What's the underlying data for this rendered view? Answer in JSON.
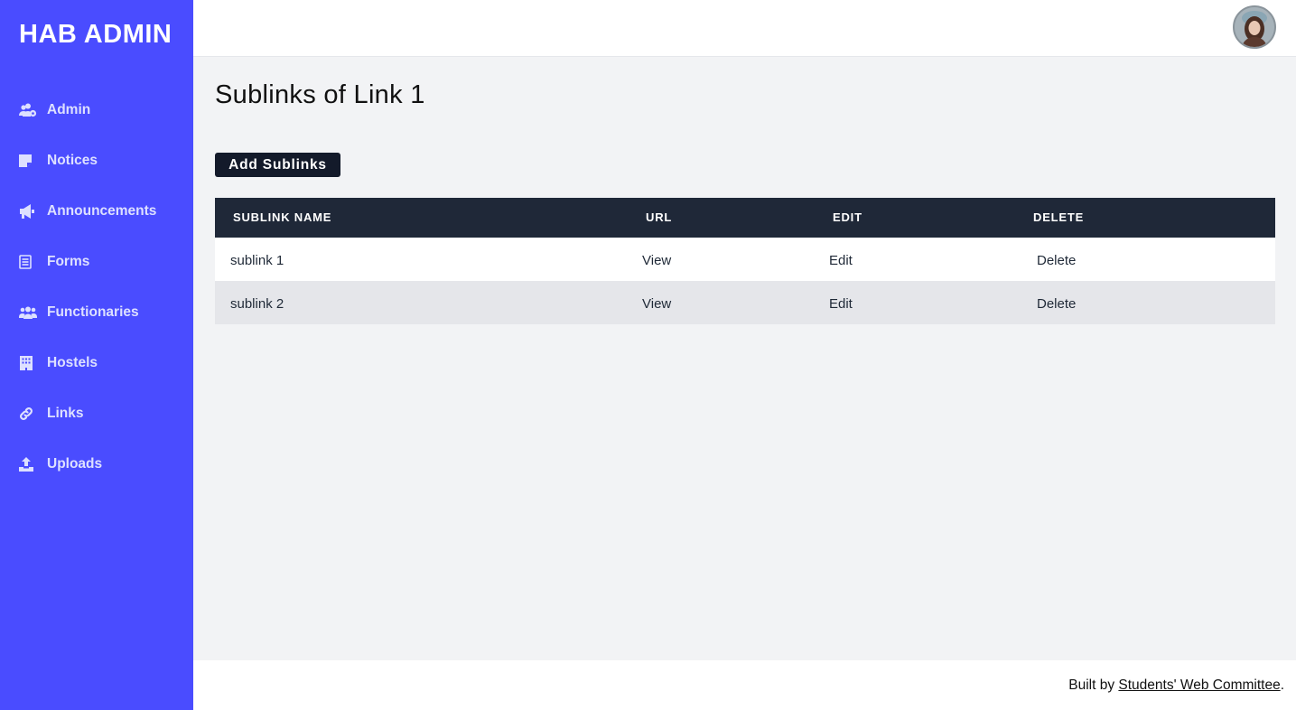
{
  "sidebar": {
    "brand": "HAB ADMIN",
    "items": [
      {
        "label": "Admin",
        "icon": "users-cog-icon"
      },
      {
        "label": "Notices",
        "icon": "sticky-note-icon"
      },
      {
        "label": "Announcements",
        "icon": "megaphone-icon"
      },
      {
        "label": "Forms",
        "icon": "form-icon"
      },
      {
        "label": "Functionaries",
        "icon": "users-icon"
      },
      {
        "label": "Hostels",
        "icon": "building-icon"
      },
      {
        "label": "Links",
        "icon": "link-icon"
      },
      {
        "label": "Uploads",
        "icon": "upload-icon"
      }
    ]
  },
  "header": {
    "avatar": "user-avatar"
  },
  "main": {
    "title": "Sublinks of Link 1",
    "add_button": "Add Sublinks",
    "table": {
      "headers": [
        "SUBLINK NAME",
        "URL",
        "EDIT",
        "DELETE"
      ],
      "rows": [
        [
          "sublink 1",
          "View",
          "Edit",
          "Delete"
        ],
        [
          "sublink 2",
          "View",
          "Edit",
          "Delete"
        ]
      ]
    }
  },
  "footer": {
    "prefix": "Built by ",
    "link": "Students' Web Committee",
    "suffix": "."
  },
  "colors": {
    "sidebar_bg": "#4a4cff",
    "table_header_bg": "#1f2838",
    "button_bg": "#131a2a",
    "main_bg": "#f2f3f5"
  }
}
